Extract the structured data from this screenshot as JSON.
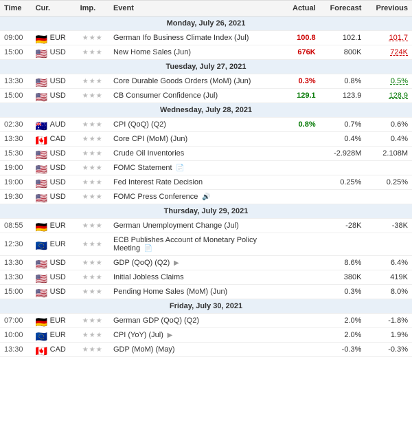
{
  "header": {
    "columns": [
      "Time",
      "Cur.",
      "Imp.",
      "Event",
      "Actual",
      "Forecast",
      "Previous"
    ]
  },
  "sections": [
    {
      "day_header": "Monday, July 26, 2021",
      "rows": [
        {
          "time": "09:00",
          "currency": "EUR",
          "flag": "🇩🇪",
          "importance": "★★★",
          "event": "German Ifo Business Climate Index (Jul)",
          "actual": "100.8",
          "actual_color": "red",
          "forecast": "102.1",
          "previous": "101.7",
          "previous_color": "red",
          "icon": ""
        },
        {
          "time": "15:00",
          "currency": "USD",
          "flag": "🇺🇸",
          "importance": "★★★",
          "event": "New Home Sales (Jun)",
          "actual": "676K",
          "actual_color": "red",
          "forecast": "800K",
          "previous": "724K",
          "previous_color": "red",
          "icon": ""
        }
      ]
    },
    {
      "day_header": "Tuesday, July 27, 2021",
      "rows": [
        {
          "time": "13:30",
          "currency": "USD",
          "flag": "🇺🇸",
          "importance": "★★★",
          "event": "Core Durable Goods Orders (MoM) (Jun)",
          "actual": "0.3%",
          "actual_color": "red",
          "forecast": "0.8%",
          "previous": "0.5%",
          "previous_color": "green",
          "icon": ""
        },
        {
          "time": "15:00",
          "currency": "USD",
          "flag": "🇺🇸",
          "importance": "★★★",
          "event": "CB Consumer Confidence (Jul)",
          "actual": "129.1",
          "actual_color": "green",
          "forecast": "123.9",
          "previous": "128.9",
          "previous_color": "green",
          "icon": ""
        }
      ]
    },
    {
      "day_header": "Wednesday, July 28, 2021",
      "rows": [
        {
          "time": "02:30",
          "currency": "AUD",
          "flag": "🇦🇺",
          "importance": "★★★",
          "event": "CPI (QoQ) (Q2)",
          "actual": "0.8%",
          "actual_color": "green",
          "forecast": "0.7%",
          "previous": "0.6%",
          "previous_color": "",
          "icon": ""
        },
        {
          "time": "13:30",
          "currency": "CAD",
          "flag": "🇨🇦",
          "importance": "★★★",
          "event": "Core CPI (MoM) (Jun)",
          "actual": "",
          "actual_color": "",
          "forecast": "0.4%",
          "previous": "0.4%",
          "previous_color": "",
          "icon": ""
        },
        {
          "time": "15:30",
          "currency": "USD",
          "flag": "🇺🇸",
          "importance": "★★★",
          "event": "Crude Oil Inventories",
          "actual": "",
          "actual_color": "",
          "forecast": "-2.928M",
          "previous": "2.108M",
          "previous_color": "",
          "icon": ""
        },
        {
          "time": "19:00",
          "currency": "USD",
          "flag": "🇺🇸",
          "importance": "★★★",
          "event": "FOMC Statement",
          "actual": "",
          "actual_color": "",
          "forecast": "",
          "previous": "",
          "previous_color": "",
          "icon": "📄"
        },
        {
          "time": "19:00",
          "currency": "USD",
          "flag": "🇺🇸",
          "importance": "★★★",
          "event": "Fed Interest Rate Decision",
          "actual": "",
          "actual_color": "",
          "forecast": "0.25%",
          "previous": "0.25%",
          "previous_color": "",
          "icon": ""
        },
        {
          "time": "19:30",
          "currency": "USD",
          "flag": "🇺🇸",
          "importance": "★★★",
          "event": "FOMC Press Conference",
          "actual": "",
          "actual_color": "",
          "forecast": "",
          "previous": "",
          "previous_color": "",
          "icon": "🔊"
        }
      ]
    },
    {
      "day_header": "Thursday, July 29, 2021",
      "rows": [
        {
          "time": "08:55",
          "currency": "EUR",
          "flag": "🇩🇪",
          "importance": "★★★",
          "event": "German Unemployment Change (Jul)",
          "actual": "",
          "actual_color": "",
          "forecast": "-28K",
          "previous": "-38K",
          "previous_color": "",
          "icon": ""
        },
        {
          "time": "12:30",
          "currency": "EUR",
          "flag": "🇪🇺",
          "importance": "★★★",
          "event": "ECB Publishes Account of Monetary Policy Meeting",
          "actual": "",
          "actual_color": "",
          "forecast": "",
          "previous": "",
          "previous_color": "",
          "icon": "📄"
        },
        {
          "time": "13:30",
          "currency": "USD",
          "flag": "🇺🇸",
          "importance": "★★★",
          "event": "GDP (QoQ) (Q2)",
          "actual": "",
          "actual_color": "",
          "forecast": "8.6%",
          "previous": "6.4%",
          "previous_color": "",
          "icon": "▶"
        },
        {
          "time": "13:30",
          "currency": "USD",
          "flag": "🇺🇸",
          "importance": "★★★",
          "event": "Initial Jobless Claims",
          "actual": "",
          "actual_color": "",
          "forecast": "380K",
          "previous": "419K",
          "previous_color": "",
          "icon": ""
        },
        {
          "time": "15:00",
          "currency": "USD",
          "flag": "🇺🇸",
          "importance": "★★★",
          "event": "Pending Home Sales (MoM) (Jun)",
          "actual": "",
          "actual_color": "",
          "forecast": "0.3%",
          "previous": "8.0%",
          "previous_color": "",
          "icon": ""
        }
      ]
    },
    {
      "day_header": "Friday, July 30, 2021",
      "rows": [
        {
          "time": "07:00",
          "currency": "EUR",
          "flag": "🇩🇪",
          "importance": "★★★",
          "event": "German GDP (QoQ) (Q2)",
          "actual": "",
          "actual_color": "",
          "forecast": "2.0%",
          "previous": "-1.8%",
          "previous_color": "",
          "icon": ""
        },
        {
          "time": "10:00",
          "currency": "EUR",
          "flag": "🇪🇺",
          "importance": "★★★",
          "event": "CPI (YoY) (Jul)",
          "actual": "",
          "actual_color": "",
          "forecast": "2.0%",
          "previous": "1.9%",
          "previous_color": "",
          "icon": "▶"
        },
        {
          "time": "13:30",
          "currency": "CAD",
          "flag": "🇨🇦",
          "importance": "★★★",
          "event": "GDP (MoM) (May)",
          "actual": "",
          "actual_color": "",
          "forecast": "-0.3%",
          "previous": "-0.3%",
          "previous_color": "",
          "icon": ""
        }
      ]
    }
  ]
}
